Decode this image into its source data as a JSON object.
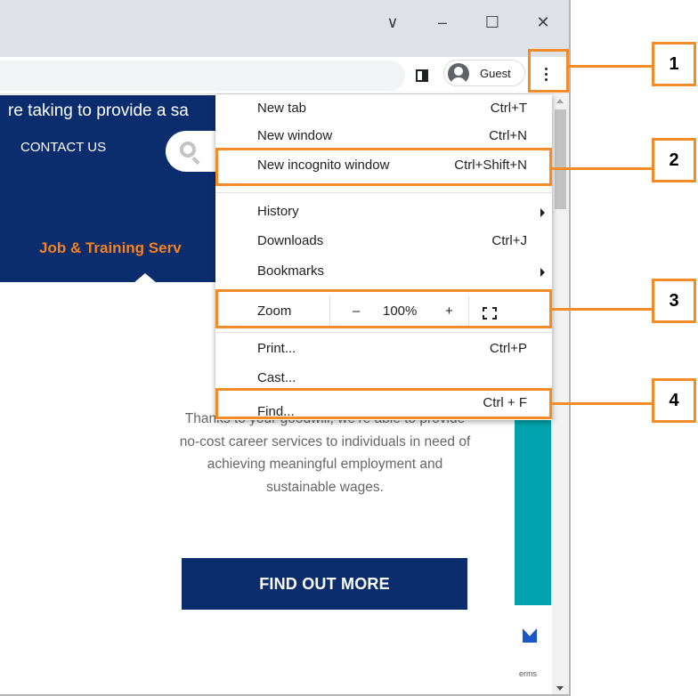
{
  "window_controls": {
    "dropdown_glyph": "∨",
    "minimize_glyph": "–",
    "maximize_glyph": "☐",
    "close_glyph": "✕"
  },
  "toolbar": {
    "profile_label": "Guest",
    "sidepanel_icon": "side-panel-icon",
    "menu_icon": "three-dot-menu-icon"
  },
  "site": {
    "banner_text": "re taking to provide a sa",
    "contact_link": "CONTACT US",
    "job_tab": "Job & Training Serv",
    "body_text": "Thanks to your goodwill, we’re able to provide no-cost career services to individuals in need of achieving meaningful employment and sustainable wages.",
    "cta_label": "FIND OUT MORE",
    "recaptcha_terms": "erms",
    "colors": {
      "navy": "#0b2d6e",
      "orange": "#f58220",
      "teal": "#00a3ad"
    }
  },
  "menu": {
    "new_tab": {
      "label": "New tab",
      "shortcut": "Ctrl+T"
    },
    "new_window": {
      "label": "New window",
      "shortcut": "Ctrl+N"
    },
    "new_incognito": {
      "label": "New incognito window",
      "shortcut": "Ctrl+Shift+N"
    },
    "history": {
      "label": "History"
    },
    "downloads": {
      "label": "Downloads",
      "shortcut": "Ctrl+J"
    },
    "bookmarks": {
      "label": "Bookmarks"
    },
    "zoom": {
      "label": "Zoom",
      "minus": "–",
      "value": "100%",
      "plus": "+"
    },
    "print": {
      "label": "Print...",
      "shortcut": "Ctrl+P"
    },
    "cast": {
      "label": "Cast..."
    },
    "find": {
      "label": "Find...",
      "shortcut": "Ctrl + F"
    }
  },
  "callouts": [
    {
      "number": "1",
      "target": "three-dot menu"
    },
    {
      "number": "2",
      "target": "New incognito window"
    },
    {
      "number": "3",
      "target": "Zoom"
    },
    {
      "number": "4",
      "target": "Find..."
    }
  ],
  "callout_color": "#f28c28"
}
